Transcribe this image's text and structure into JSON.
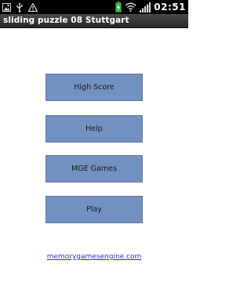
{
  "status_bar": {
    "time": "02:51",
    "left_icons": [
      "image-icon",
      "usb-icon",
      "warning-icon"
    ],
    "right_icons": [
      "battery-charging-icon",
      "wifi-icon",
      "signal-icon"
    ]
  },
  "title_bar": {
    "title": "sliding puzzle 08 Stuttgart"
  },
  "menu": {
    "high_score": "High Score",
    "help": "Help",
    "mge_games": "MGE Games",
    "play": "Play"
  },
  "footer": {
    "link_text": "memorygamesengine.com"
  },
  "colors": {
    "button_fill": "#7391c0",
    "link": "#2f2fd8",
    "battery_green": "#39b84a"
  }
}
